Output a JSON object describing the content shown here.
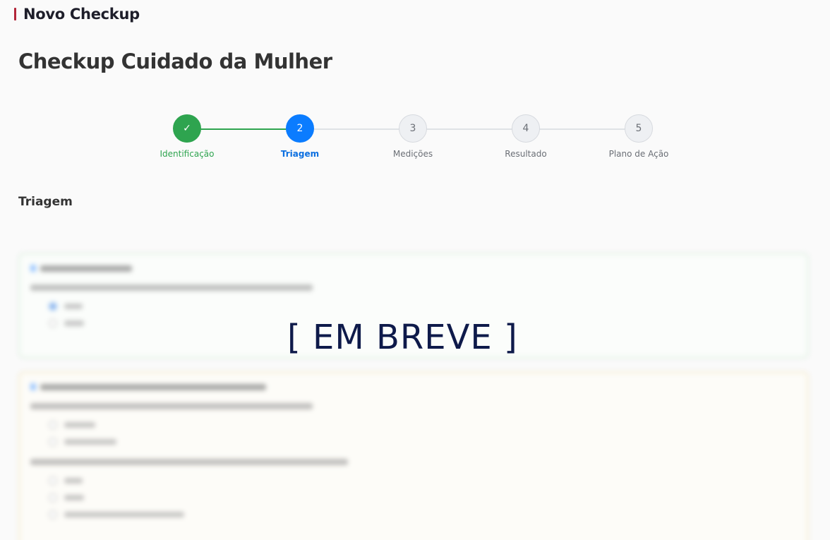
{
  "header": {
    "title": "Novo Checkup"
  },
  "page": {
    "title": "Checkup Cuidado da Mulher"
  },
  "stepper": {
    "steps": [
      {
        "number": "✓",
        "label": "Identificação",
        "state": "done"
      },
      {
        "number": "2",
        "label": "Triagem",
        "state": "active"
      },
      {
        "number": "3",
        "label": "Medições",
        "state": "pending"
      },
      {
        "number": "4",
        "label": "Resultado",
        "state": "pending"
      },
      {
        "number": "5",
        "label": "Plano de Ação",
        "state": "pending"
      }
    ]
  },
  "section": {
    "title": "Triagem"
  },
  "overlay": {
    "text": "[ EM BREVE ]"
  },
  "colors": {
    "done": "#2ea44f",
    "active": "#0b7cff",
    "brand_accent": "#b3263a"
  }
}
